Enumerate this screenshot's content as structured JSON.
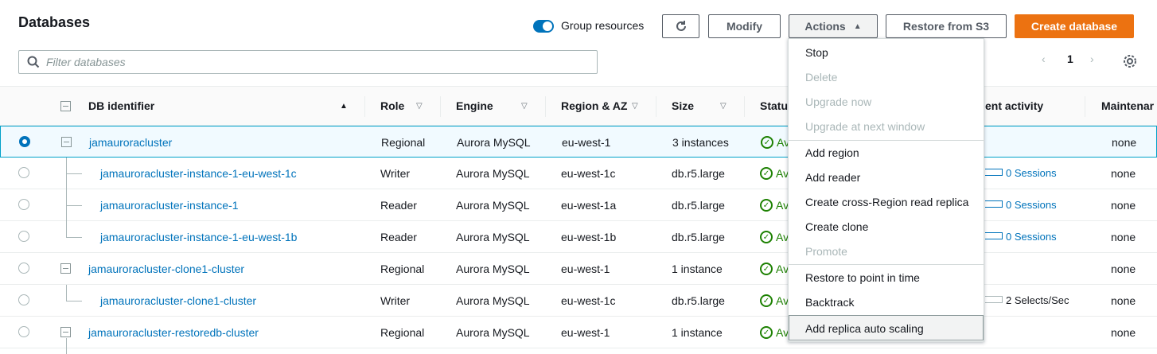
{
  "header": {
    "title": "Databases",
    "group_resources_label": "Group resources",
    "group_resources_on": true,
    "modify_label": "Modify",
    "actions_label": "Actions",
    "restore_s3_label": "Restore from S3",
    "create_label": "Create database"
  },
  "search": {
    "placeholder": "Filter databases"
  },
  "pager": {
    "page": "1"
  },
  "columns": {
    "db_identifier": "DB identifier",
    "role": "Role",
    "engine": "Engine",
    "region": "Region & AZ",
    "size": "Size",
    "status": "Status",
    "activity": "ent activity",
    "maintenance": "Maintenar"
  },
  "rows": [
    {
      "id": "jamauroracluster",
      "role": "Regional",
      "engine": "Aurora MySQL",
      "region": "eu-west-1",
      "size": "3 instances",
      "status": "Av",
      "activity": "",
      "maintenance": "none"
    },
    {
      "id": "jamauroracluster-instance-1-eu-west-1c",
      "role": "Writer",
      "engine": "Aurora MySQL",
      "region": "eu-west-1c",
      "size": "db.r5.large",
      "status": "Av",
      "activity": "0 Sessions",
      "maintenance": "none"
    },
    {
      "id": "jamauroracluster-instance-1",
      "role": "Reader",
      "engine": "Aurora MySQL",
      "region": "eu-west-1a",
      "size": "db.r5.large",
      "status": "Av",
      "activity": "0 Sessions",
      "maintenance": "none"
    },
    {
      "id": "jamauroracluster-instance-1-eu-west-1b",
      "role": "Reader",
      "engine": "Aurora MySQL",
      "region": "eu-west-1b",
      "size": "db.r5.large",
      "status": "Av",
      "activity": "0 Sessions",
      "maintenance": "none"
    },
    {
      "id": "jamauroracluster-clone1-cluster",
      "role": "Regional",
      "engine": "Aurora MySQL",
      "region": "eu-west-1",
      "size": "1 instance",
      "status": "Av",
      "activity": "",
      "maintenance": "none"
    },
    {
      "id": "jamauroracluster-clone1-cluster",
      "role": "Writer",
      "engine": "Aurora MySQL",
      "region": "eu-west-1c",
      "size": "db.r5.large",
      "status": "Av",
      "activity": "2 Selects/Sec",
      "maintenance": "none"
    },
    {
      "id": "jamauroracluster-restoredb-cluster",
      "role": "Regional",
      "engine": "Aurora MySQL",
      "region": "eu-west-1",
      "size": "1 instance",
      "status": "Av",
      "activity": "",
      "maintenance": "none"
    }
  ],
  "actions_menu": [
    {
      "label": "Stop",
      "disabled": false
    },
    {
      "label": "Delete",
      "disabled": true
    },
    {
      "label": "Upgrade now",
      "disabled": true
    },
    {
      "label": "Upgrade at next window",
      "disabled": true
    },
    {
      "label": "Add region",
      "disabled": false
    },
    {
      "label": "Add reader",
      "disabled": false
    },
    {
      "label": "Create cross-Region read replica",
      "disabled": false
    },
    {
      "label": "Create clone",
      "disabled": false
    },
    {
      "label": "Promote",
      "disabled": true
    },
    {
      "label": "Restore to point in time",
      "disabled": false
    },
    {
      "label": "Backtrack",
      "disabled": false
    },
    {
      "label": "Add replica auto scaling",
      "disabled": false
    }
  ],
  "colors": {
    "accent": "#0073bb",
    "primary_button": "#ec7211",
    "status_ok": "#1d8102"
  }
}
